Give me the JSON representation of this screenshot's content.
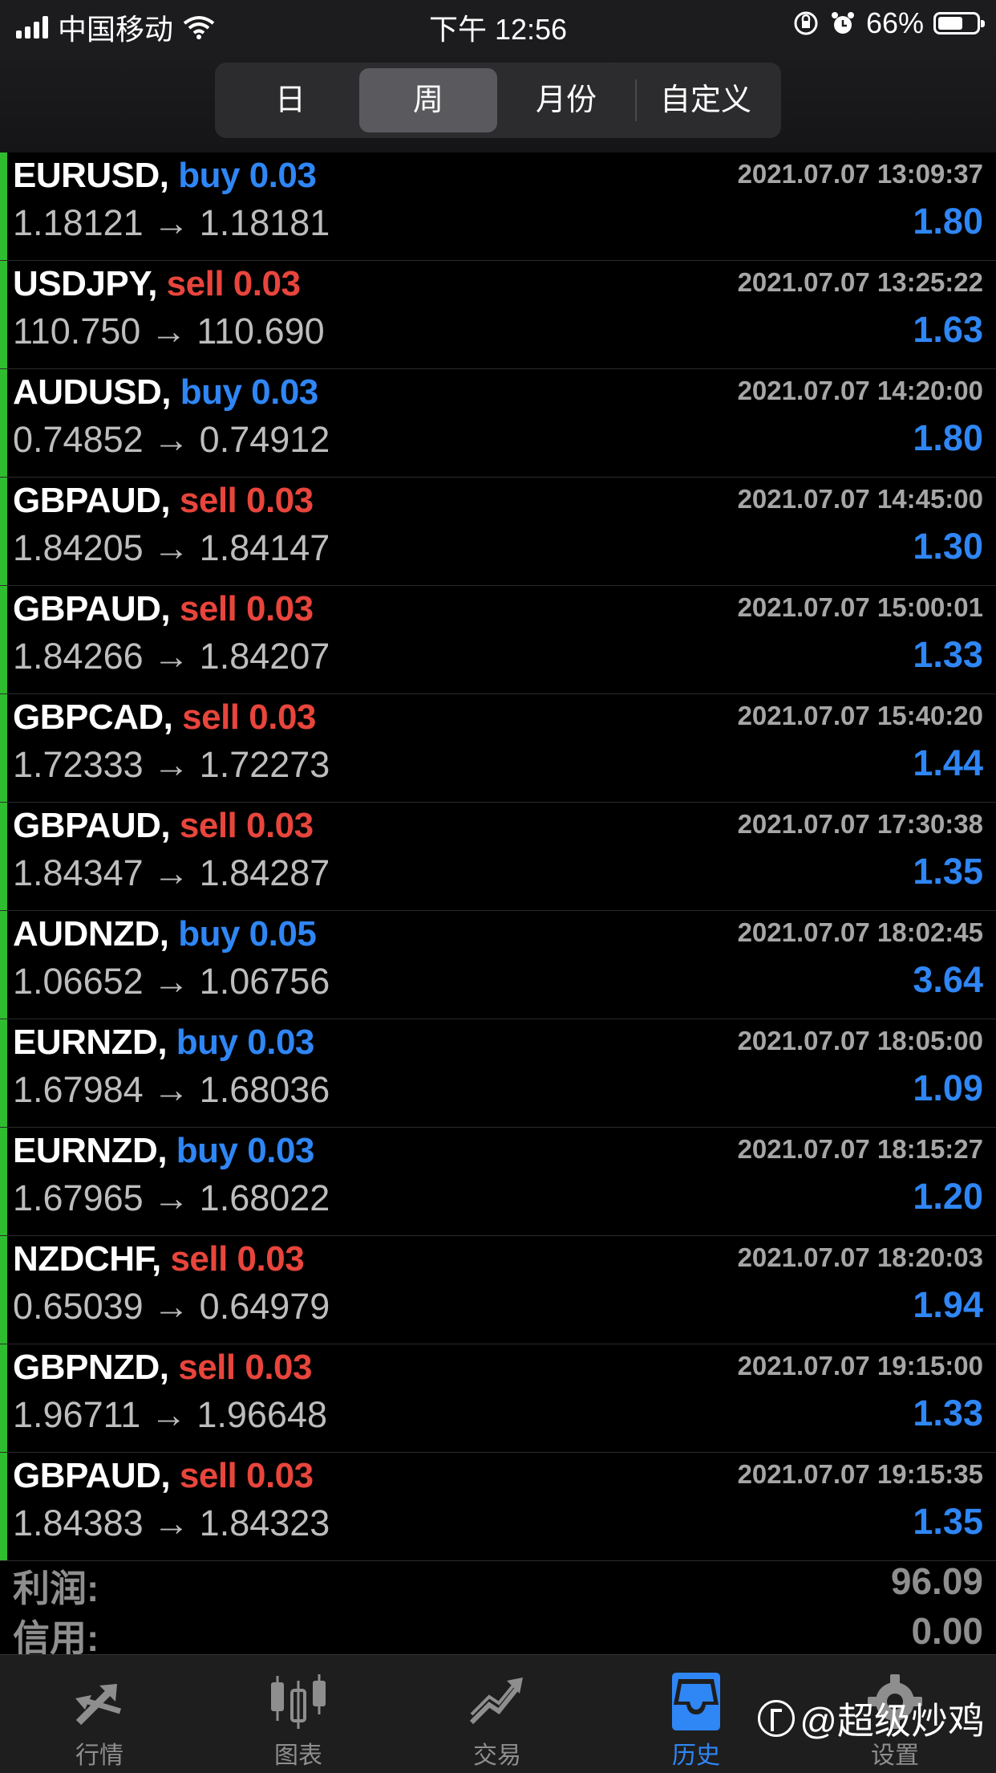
{
  "status_bar": {
    "carrier": "中国移动",
    "time": "下午 12:56",
    "battery_text": "66%",
    "battery_level": 0.66
  },
  "segmented": {
    "options": [
      "日",
      "周",
      "月份",
      "自定义"
    ],
    "selected": "周"
  },
  "trades": [
    {
      "symbol": "EURUSD,",
      "side": "buy 0.03",
      "type": "buy",
      "time": "2021.07.07 13:09:37",
      "prices": "1.18121 → 1.18181",
      "profit": "1.80"
    },
    {
      "symbol": "USDJPY,",
      "side": "sell 0.03",
      "type": "sell",
      "time": "2021.07.07 13:25:22",
      "prices": "110.750 → 110.690",
      "profit": "1.63"
    },
    {
      "symbol": "AUDUSD,",
      "side": "buy 0.03",
      "type": "buy",
      "time": "2021.07.07 14:20:00",
      "prices": "0.74852 → 0.74912",
      "profit": "1.80"
    },
    {
      "symbol": "GBPAUD,",
      "side": "sell 0.03",
      "type": "sell",
      "time": "2021.07.07 14:45:00",
      "prices": "1.84205 → 1.84147",
      "profit": "1.30"
    },
    {
      "symbol": "GBPAUD,",
      "side": "sell 0.03",
      "type": "sell",
      "time": "2021.07.07 15:00:01",
      "prices": "1.84266 → 1.84207",
      "profit": "1.33"
    },
    {
      "symbol": "GBPCAD,",
      "side": "sell 0.03",
      "type": "sell",
      "time": "2021.07.07 15:40:20",
      "prices": "1.72333 → 1.72273",
      "profit": "1.44"
    },
    {
      "symbol": "GBPAUD,",
      "side": "sell 0.03",
      "type": "sell",
      "time": "2021.07.07 17:30:38",
      "prices": "1.84347 → 1.84287",
      "profit": "1.35"
    },
    {
      "symbol": "AUDNZD,",
      "side": "buy 0.05",
      "type": "buy",
      "time": "2021.07.07 18:02:45",
      "prices": "1.06652 → 1.06756",
      "profit": "3.64"
    },
    {
      "symbol": "EURNZD,",
      "side": "buy 0.03",
      "type": "buy",
      "time": "2021.07.07 18:05:00",
      "prices": "1.67984 → 1.68036",
      "profit": "1.09"
    },
    {
      "symbol": "EURNZD,",
      "side": "buy 0.03",
      "type": "buy",
      "time": "2021.07.07 18:15:27",
      "prices": "1.67965 → 1.68022",
      "profit": "1.20"
    },
    {
      "symbol": "NZDCHF,",
      "side": "sell 0.03",
      "type": "sell",
      "time": "2021.07.07 18:20:03",
      "prices": "0.65039 → 0.64979",
      "profit": "1.94"
    },
    {
      "symbol": "GBPNZD,",
      "side": "sell 0.03",
      "type": "sell",
      "time": "2021.07.07 19:15:00",
      "prices": "1.96711 → 1.96648",
      "profit": "1.33"
    },
    {
      "symbol": "GBPAUD,",
      "side": "sell 0.03",
      "type": "sell",
      "time": "2021.07.07 19:15:35",
      "prices": "1.84383 → 1.84323",
      "profit": "1.35"
    }
  ],
  "summary": {
    "profit_label": "利润:",
    "profit_value": "96.09",
    "credit_label": "信用:",
    "credit_value": "0.00"
  },
  "tabs": [
    {
      "label": "行情",
      "icon": "quotes-arrows-icon"
    },
    {
      "label": "图表",
      "icon": "candlestick-chart-icon"
    },
    {
      "label": "交易",
      "icon": "trade-trend-icon"
    },
    {
      "label": "历史",
      "icon": "history-inbox-icon"
    },
    {
      "label": "设置",
      "icon": "gear-icon"
    }
  ],
  "active_tab": "历史",
  "watermark": "@超级炒鸡",
  "colors": {
    "buy": "#2f86f5",
    "sell": "#e8453c",
    "profit": "#2f86f5",
    "row_indicator": "#2fbd2f",
    "active_tab": "#2f86f5"
  }
}
